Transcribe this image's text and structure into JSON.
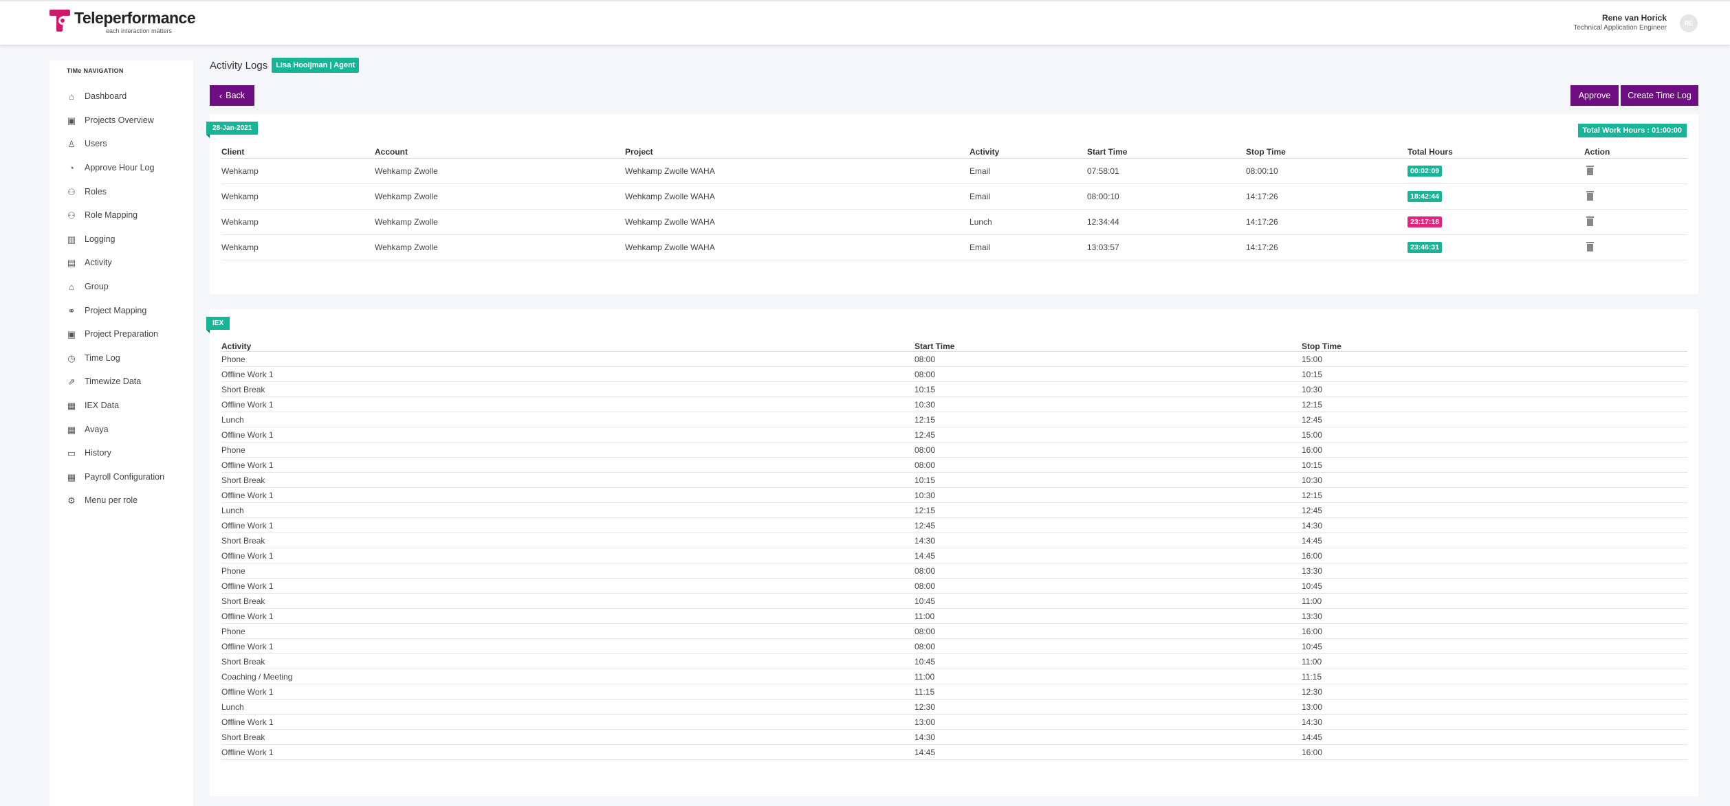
{
  "header": {
    "brand_name": "Teleperformance",
    "brand_tagline": "each interaction matters",
    "user_name": "Rene van Horick",
    "user_role": "Technical Application Engineer",
    "avatar_initials": "RE"
  },
  "sidebar": {
    "title": "TIMe NAVIGATION",
    "items": [
      {
        "label": "Dashboard",
        "icon": "home-icon"
      },
      {
        "label": "Projects Overview",
        "icon": "briefcase-icon"
      },
      {
        "label": "Users",
        "icon": "user-icon"
      },
      {
        "label": "Approve Hour Log",
        "icon": "clock-icon"
      },
      {
        "label": "Roles",
        "icon": "users-icon"
      },
      {
        "label": "Role Mapping",
        "icon": "users-icon"
      },
      {
        "label": "Logging",
        "icon": "document-icon"
      },
      {
        "label": "Activity",
        "icon": "clipboard-icon"
      },
      {
        "label": "Group",
        "icon": "bag-icon"
      },
      {
        "label": "Project Mapping",
        "icon": "handshake-icon"
      },
      {
        "label": "Project Preparation",
        "icon": "briefcase-icon"
      },
      {
        "label": "Time Log",
        "icon": "alarm-icon"
      },
      {
        "label": "Timewize Data",
        "icon": "share-icon"
      },
      {
        "label": "IEX Data",
        "icon": "archive-icon"
      },
      {
        "label": "Avaya",
        "icon": "archive-icon"
      },
      {
        "label": "History",
        "icon": "folder-icon"
      },
      {
        "label": "Payroll Configuration",
        "icon": "archive-icon"
      },
      {
        "label": "Menu per role",
        "icon": "gear-icon"
      }
    ]
  },
  "main": {
    "title": "Activity Logs",
    "agent_badge": "Lisa Hooijman | Agent",
    "back_label": "Back",
    "approve_label": "Approve",
    "create_label": "Create Time Log"
  },
  "activity_card": {
    "date_tag": "28-Jan-2021",
    "total_label": "Total Work Hours : 01:00:00",
    "headers": [
      "Client",
      "Account",
      "Project",
      "Activity",
      "Start Time",
      "Stop Time",
      "Total Hours",
      "Action"
    ],
    "rows": [
      {
        "client": "Wehkamp",
        "account": "Wehkamp Zwolle",
        "project": "Wehkamp Zwolle WAHA",
        "activity": "Email",
        "start": "07:58:01",
        "stop": "08:00:10",
        "total": "00:02:09",
        "total_color": "#18b497"
      },
      {
        "client": "Wehkamp",
        "account": "Wehkamp Zwolle",
        "project": "Wehkamp Zwolle WAHA",
        "activity": "Email",
        "start": "08:00:10",
        "stop": "14:17:26",
        "total": "18:42:44",
        "total_color": "#18b497"
      },
      {
        "client": "Wehkamp",
        "account": "Wehkamp Zwolle",
        "project": "Wehkamp Zwolle WAHA",
        "activity": "Lunch",
        "start": "12:34:44",
        "stop": "14:17:26",
        "total": "23:17:18",
        "total_color": "#e3237c"
      },
      {
        "client": "Wehkamp",
        "account": "Wehkamp Zwolle",
        "project": "Wehkamp Zwolle WAHA",
        "activity": "Email",
        "start": "13:03:57",
        "stop": "14:17:26",
        "total": "23:46:31",
        "total_color": "#18b497"
      }
    ]
  },
  "iex_card": {
    "tag": "IEX",
    "headers": [
      "Activity",
      "Start Time",
      "Stop Time"
    ],
    "rows": [
      [
        "Phone",
        "08:00",
        "15:00"
      ],
      [
        "Offline Work 1",
        "08:00",
        "10:15"
      ],
      [
        "Short Break",
        "10:15",
        "10:30"
      ],
      [
        "Offline Work 1",
        "10:30",
        "12:15"
      ],
      [
        "Lunch",
        "12:15",
        "12:45"
      ],
      [
        "Offline Work 1",
        "12:45",
        "15:00"
      ],
      [
        "Phone",
        "08:00",
        "16:00"
      ],
      [
        "Offline Work 1",
        "08:00",
        "10:15"
      ],
      [
        "Short Break",
        "10:15",
        "10:30"
      ],
      [
        "Offline Work 1",
        "10:30",
        "12:15"
      ],
      [
        "Lunch",
        "12:15",
        "12:45"
      ],
      [
        "Offline Work 1",
        "12:45",
        "14:30"
      ],
      [
        "Short Break",
        "14:30",
        "14:45"
      ],
      [
        "Offline Work 1",
        "14:45",
        "16:00"
      ],
      [
        "Phone",
        "08:00",
        "13:30"
      ],
      [
        "Offline Work 1",
        "08:00",
        "10:45"
      ],
      [
        "Short Break",
        "10:45",
        "11:00"
      ],
      [
        "Offline Work 1",
        "11:00",
        "13:30"
      ],
      [
        "Phone",
        "08:00",
        "16:00"
      ],
      [
        "Offline Work 1",
        "08:00",
        "10:45"
      ],
      [
        "Short Break",
        "10:45",
        "11:00"
      ],
      [
        "Coaching / Meeting",
        "11:00",
        "11:15"
      ],
      [
        "Offline Work 1",
        "11:15",
        "12:30"
      ],
      [
        "Lunch",
        "12:30",
        "13:00"
      ],
      [
        "Offline Work 1",
        "13:00",
        "14:30"
      ],
      [
        "Short Break",
        "14:30",
        "14:45"
      ],
      [
        "Offline Work 1",
        "14:45",
        "16:00"
      ]
    ]
  },
  "colors": {
    "brand": "#cf1a6a",
    "primary_button": "#6f0d82",
    "accent_green": "#18b497",
    "accent_pink": "#e3237c"
  }
}
